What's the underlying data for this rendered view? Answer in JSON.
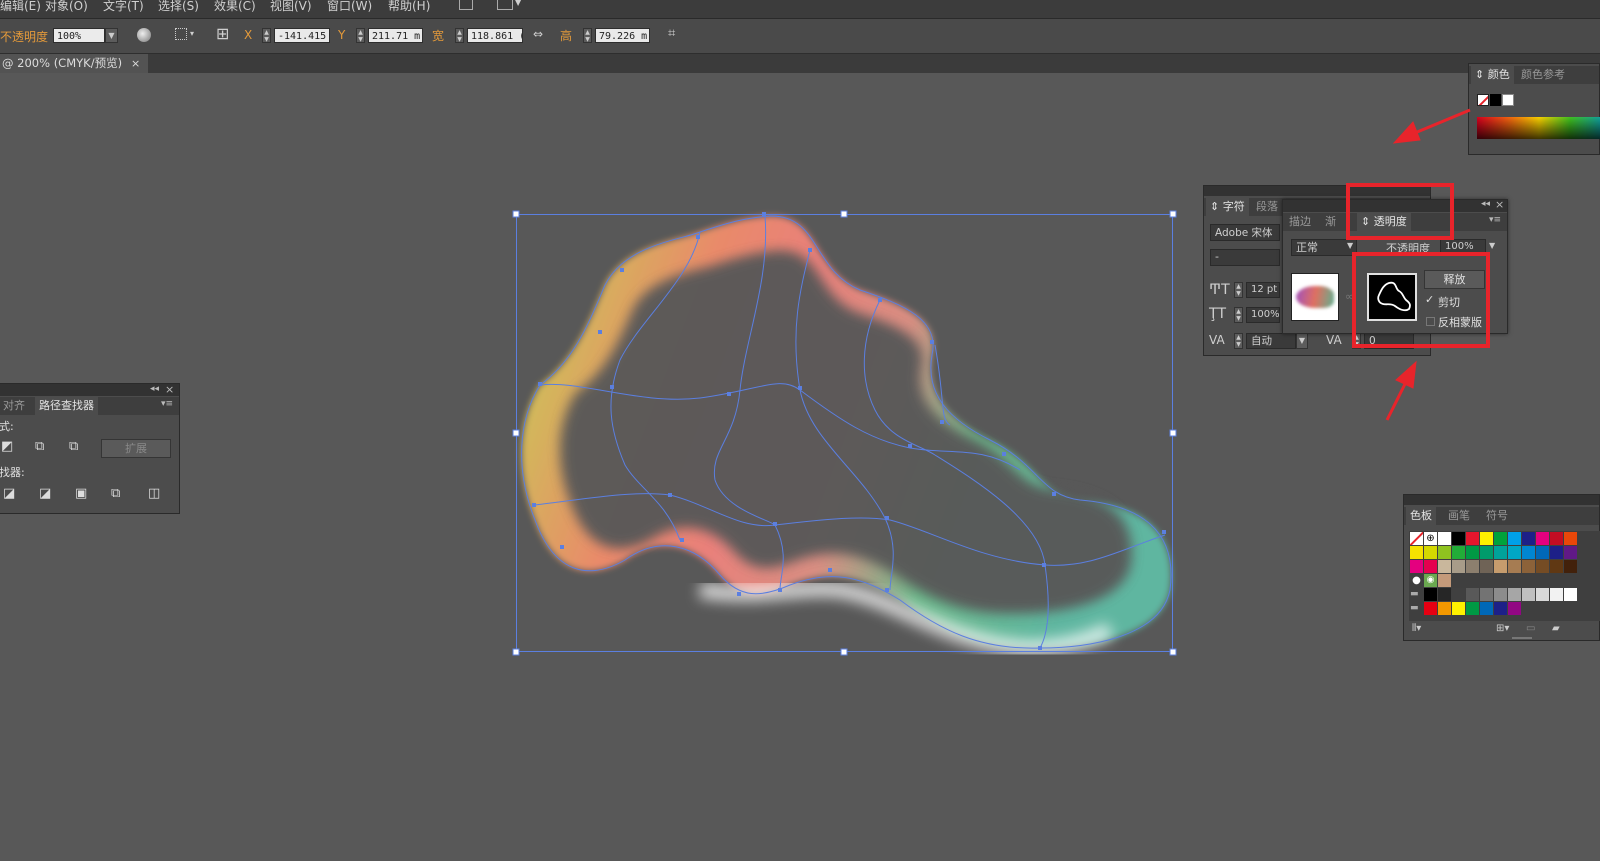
{
  "menu": [
    "编辑(E)",
    "对象(O)",
    "文字(T)",
    "选择(S)",
    "效果(C)",
    "视图(V)",
    "窗口(W)",
    "帮助(H)"
  ],
  "control": {
    "opacity_label": "不透明度",
    "opacity_value": "100%",
    "x_label": "X",
    "x_value": "-141.415",
    "y_label": "Y",
    "y_value": "211.71 m",
    "w_label": "宽",
    "w_value": "118.861 (",
    "h_label": "高",
    "h_value": "79.226 m"
  },
  "document_tab": {
    "title": "@ 200% (CMYK/预览)",
    "close": "×"
  },
  "color_panel": {
    "tab_color": "颜色",
    "tab_guide": "颜色参考"
  },
  "character_panel": {
    "tab_character": "字符",
    "tab_paragraph": "段落",
    "font_name": "Adobe 宋体",
    "font_style": "-",
    "size_value": "12 pt",
    "leading_value": "100%",
    "kerning_value": "自动",
    "tracking_value": "0"
  },
  "transparency_panel": {
    "tab_stroke": "描边",
    "tab_gradient": "渐",
    "tab_transparency": "透明度",
    "blend_mode": "正常",
    "opacity_label": "不透明度",
    "opacity_value": "100%",
    "release_button": "释放",
    "clip_label": "剪切",
    "clip_checked": true,
    "invert_label": "反相蒙版",
    "invert_checked": false
  },
  "pathfinder_panel": {
    "tab_align": "对齐",
    "tab_pathfinder": "路径查找器",
    "shape_modes_label": "式:",
    "pathfinders_label": "找器:",
    "expand_button": "扩展"
  },
  "swatches_panel": {
    "tab_swatches": "色板",
    "tab_brushes": "画笔",
    "tab_symbols": "符号"
  },
  "colors": {
    "highlight_red": "#e8242b",
    "anchor_blue": "#5b7fe0",
    "accent_orange": "#e49a3a"
  }
}
